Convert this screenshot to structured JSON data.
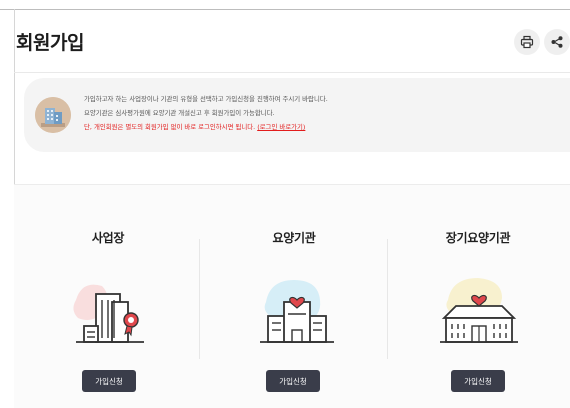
{
  "page": {
    "title": "회원가입"
  },
  "toolbar": {
    "print_icon": "printer-icon",
    "share_icon": "share-icon"
  },
  "notice": {
    "icon": "building-icon",
    "line1": "가입하고자 하는 사업장이나 기관의 유형을 선택하고 가입신청을 진행하여 주시기 바랍니다.",
    "line2": "요양기관은 심사평가원에 요양기관 개설신고 후 회원가입이 가능합니다.",
    "line3_text": "단, 개인회원은 별도의 회원가입 없이 바로 로그인하시면 됩니다. ",
    "line3_link": "(로그인 바로가기)"
  },
  "options": [
    {
      "title": "사업장",
      "icon": "office-building-award-icon",
      "button": "가입신청",
      "accent": "#f9dede"
    },
    {
      "title": "요양기관",
      "icon": "clinic-heart-icon",
      "button": "가입신청",
      "accent": "#d6eef7"
    },
    {
      "title": "장기요양기관",
      "icon": "care-facility-heart-icon",
      "button": "가입신청",
      "accent": "#f8f1cf"
    }
  ],
  "colors": {
    "button_bg": "#3a3d4a",
    "warning_text": "#e21c1c",
    "notice_bg": "#f4f4f4"
  }
}
